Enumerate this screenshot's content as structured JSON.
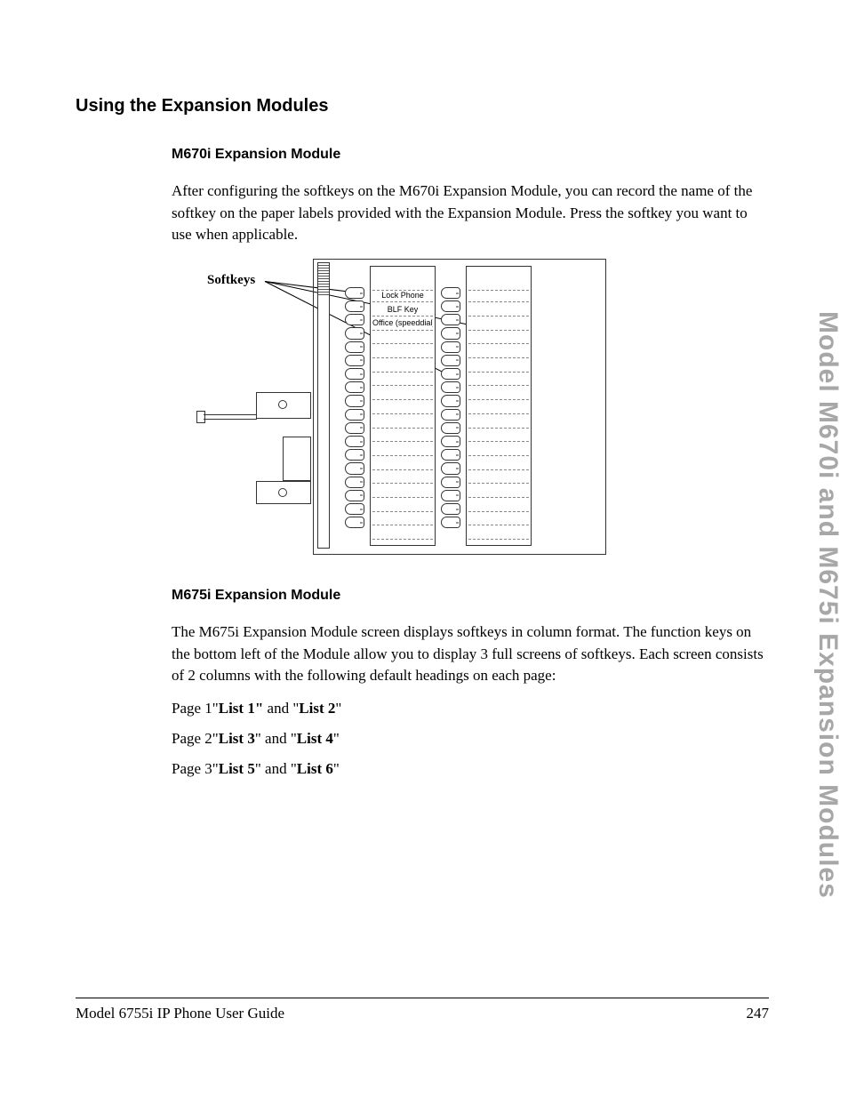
{
  "section_title": "Using the Expansion Modules",
  "m670i": {
    "heading": "M670i Expansion Module",
    "paragraph": "After configuring the softkeys on the M670i Expansion Module, you can record the name of the softkey on the paper labels provided with the Expansion Module. Press the softkey you want to use when applicable."
  },
  "figure": {
    "callout": "Softkeys",
    "labels_col1": [
      "Lock Phone",
      "BLF Key",
      "Office (speeddial)",
      "",
      "",
      "",
      "",
      "",
      "",
      "",
      "",
      "",
      "",
      "",
      "",
      "",
      "",
      ""
    ],
    "labels_col2": [
      "",
      "",
      "",
      "",
      "",
      "",
      "",
      "",
      "",
      "",
      "",
      "",
      "",
      "",
      "",
      "",
      "",
      ""
    ]
  },
  "m675i": {
    "heading": "M675i Expansion Module",
    "paragraph": "The M675i Expansion Module screen displays softkeys in column format. The function keys on the bottom left of the Module allow you to display 3 full screens of softkeys. Each screen consists of 2 columns with the following default headings on each page:",
    "pages": [
      {
        "prefix": "Page 1\"",
        "a": "List 1\"",
        "mid": " and \"",
        "b": "List 2",
        "suffix": "\""
      },
      {
        "prefix": "Page 2\"",
        "a": "List 3",
        "mid": "\" and \"",
        "b": "List 4",
        "suffix": "\""
      },
      {
        "prefix": "Page 3\"",
        "a": "List 5",
        "mid": "\" and \"",
        "b": "List 6",
        "suffix": "\""
      }
    ]
  },
  "side_tab": "Model M670i and M675i Expansion Modules",
  "footer": {
    "left": "Model 6755i IP Phone User Guide",
    "right": "247"
  }
}
